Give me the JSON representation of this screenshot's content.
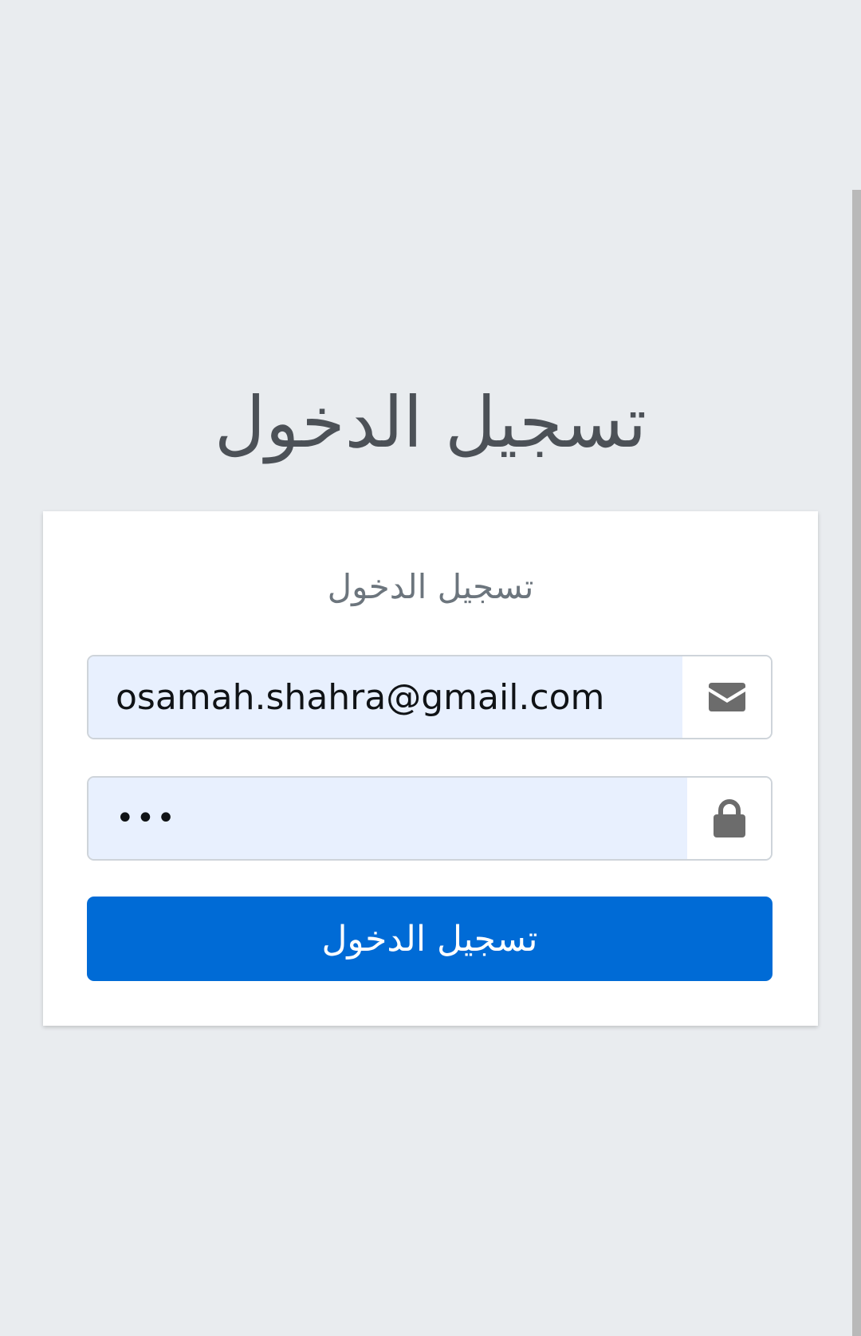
{
  "page": {
    "title": "تسجيل الدخول"
  },
  "card": {
    "title": "تسجيل الدخول",
    "email": {
      "value": "osamah.shahra@gmail.com",
      "icon": "envelope-icon"
    },
    "password": {
      "value": "•••",
      "icon": "lock-icon"
    },
    "submit_label": "تسجيل الدخول"
  },
  "colors": {
    "background": "#e9ecef",
    "accent": "#006bd6",
    "autofill": "#e8f0fe",
    "icon": "#6c6c6c"
  }
}
